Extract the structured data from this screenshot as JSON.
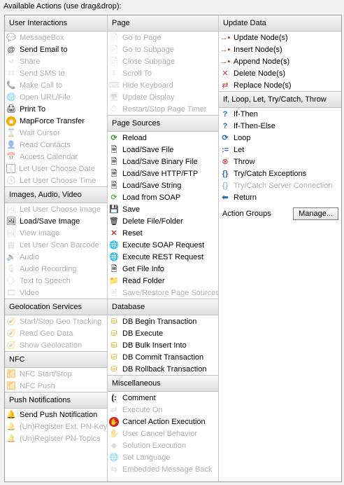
{
  "title": "Available Actions (use drag&drop):",
  "sections": {
    "user_interactions": {
      "header": "User Interactions",
      "items": [
        "MessageBox",
        "Send Email to",
        "Share",
        "Send SMS to",
        "Make Call to",
        "Open URL/File",
        "Print To",
        "MapForce Transfer",
        "Wait Cursor",
        "Read Contacts",
        "Access Calendar",
        "Let User Choose Date",
        "Let User Choose Time"
      ]
    },
    "images_audio_video": {
      "header": "Images, Audio, Video",
      "items": [
        "Let User Choose Image",
        "Load/Save Image",
        "View Image",
        "Let User Scan Barcode",
        "Audio",
        "Audio Recording",
        "Text to Speech",
        "Video"
      ]
    },
    "geolocation": {
      "header": "Geolocation Services",
      "items": [
        "Start/Stop Geo Tracking",
        "Read Geo Data",
        "Show Geolocation"
      ]
    },
    "nfc": {
      "header": "NFC",
      "items": [
        "NFC Start/Stop",
        "NFC Push"
      ]
    },
    "push": {
      "header": "Push Notifications",
      "items": [
        "Send Push Notification",
        "(Un)Register Ext. PN-Key",
        "(Un)Register PN-Topics"
      ]
    },
    "page": {
      "header": "Page",
      "items": [
        "Go to Page",
        "Go to Subpage",
        "Close Subpage",
        "Scroll To",
        "Hide Keyboard",
        "Update Display",
        "Restart/Stop Page Timer"
      ]
    },
    "page_sources": {
      "header": "Page Sources",
      "items": [
        "Reload",
        "Load/Save File",
        "Load/Save Binary File",
        "Load/Save HTTP/FTP",
        "Load/Save String",
        "Load from SOAP",
        "Save",
        "Delete File/Folder",
        "Reset",
        "Execute SOAP Request",
        "Execute REST Request",
        "Get File Info",
        "Read Folder",
        "Save/Restore Page Sources"
      ]
    },
    "database": {
      "header": "Database",
      "items": [
        "DB Begin Transaction",
        "DB Execute",
        "DB Bulk Insert Into",
        "DB Commit Transaction",
        "DB Rollback Transaction"
      ]
    },
    "misc": {
      "header": "Miscellaneous",
      "items": [
        "Comment",
        "Execute On",
        "Cancel Action Execution",
        "User Cancel Behavior",
        "Solution Execution",
        "Set Language",
        "Embedded Message Back"
      ]
    },
    "update_data": {
      "header": "Update Data",
      "items": [
        "Update Node(s)",
        "Insert Node(s)",
        "Append Node(s)",
        "Delete Node(s)",
        "Replace Node(s)"
      ]
    },
    "flow": {
      "header": "If, Loop, Let, Try/Catch, Throw",
      "items": [
        "If-Then",
        "If-Then-Else",
        "Loop",
        "Let",
        "Throw",
        "Try/Catch Exceptions",
        "Try/Catch Server Connection",
        "Return"
      ]
    }
  },
  "action_groups": {
    "label": "Action Groups",
    "button": "Manage..."
  }
}
